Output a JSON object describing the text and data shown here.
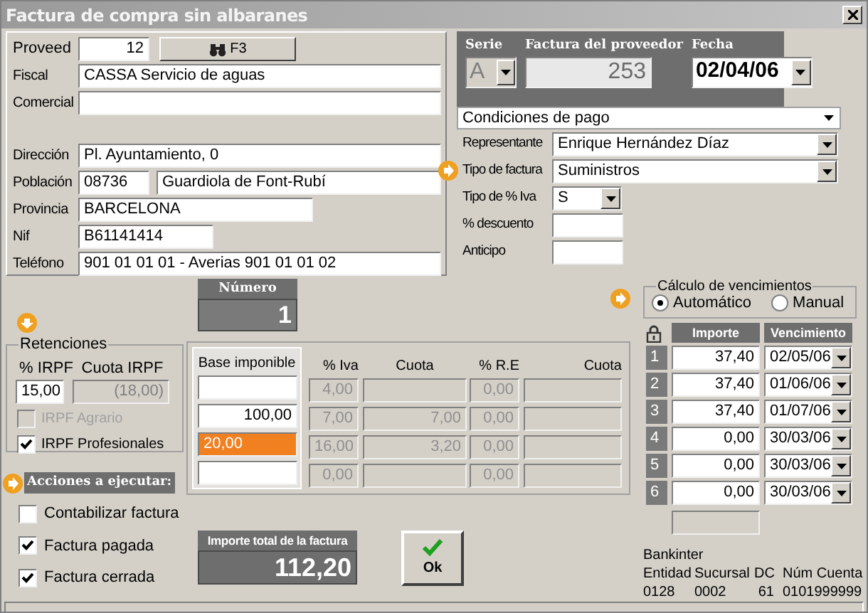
{
  "window": {
    "title": "Factura de compra sin albaranes"
  },
  "proveedor": {
    "label": "Proveed",
    "value": "12",
    "search_button": "F3"
  },
  "supplier_fields": [
    {
      "label": "Fiscal",
      "values": [
        "CASSA Servicio de aguas"
      ]
    },
    {
      "label": "Comercial"
    },
    {
      "label": "Dirección",
      "values": [
        "Pl. Ayuntamiento, 0"
      ]
    },
    {
      "label": "Población",
      "values": [
        "08736",
        "Guardiola de Font-Rubí"
      ]
    },
    {
      "label": "Provincia",
      "values": [
        "BARCELONA"
      ]
    },
    {
      "label": "Nif",
      "values": [
        "B61141414"
      ]
    },
    {
      "label": "Teléfono",
      "values": [
        "901 01 01 01 - Averias 901 01 01 02"
      ]
    }
  ],
  "invoice_header": {
    "serie": {
      "label": "Serie",
      "value": "A"
    },
    "number": {
      "label": "Factura del proveedor",
      "value": "253"
    },
    "date": {
      "label": "Fecha",
      "value": "02/04/06"
    }
  },
  "payment_conditions": "Condiciones de pago",
  "details": [
    {
      "label": "Representante",
      "value": "Enrique Hernández Díaz",
      "kind": "dropdown",
      "marked": false
    },
    {
      "label": "Tipo de factura",
      "value": "Suministros",
      "kind": "dropdown",
      "marked": true
    },
    {
      "label": "Tipo de % Iva",
      "value": "S",
      "kind": "dropdown",
      "marked": false
    },
    {
      "label": "% descuento",
      "kind": "field",
      "marked": false
    },
    {
      "label": "Anticipo",
      "kind": "field",
      "marked": false
    }
  ],
  "numero": {
    "label": "Número",
    "value": "1"
  },
  "retenciones": {
    "title": "Retenciones",
    "irpf_label": "% IRPF",
    "irpf": "15,00",
    "cuota_label": "Cuota IRPF",
    "cuota": "(18,00)",
    "options": [
      {
        "label": "IRPF Agrario",
        "checked": false,
        "disabled": true
      },
      {
        "label": "IRPF Profesionales",
        "checked": true,
        "disabled": false
      }
    ]
  },
  "tax_table": {
    "columns": [
      "Base imponible",
      "% Iva",
      "Cuota",
      "% R.E",
      "Cuota"
    ],
    "rows": [
      {
        "iva": "4,00",
        "re": "0,00",
        "focused": false
      },
      {
        "base": "100,00",
        "iva": "7,00",
        "cuota": "7,00",
        "re": "0,00",
        "focused": false
      },
      {
        "base": "20,00",
        "iva": "16,00",
        "cuota": "3,20",
        "re": "0,00",
        "focused": true
      },
      {
        "iva": "0,00",
        "re": "0,00",
        "focused": false
      }
    ]
  },
  "acciones": {
    "title": "Acciones a ejecutar:",
    "items": [
      {
        "label": "Contabilizar factura",
        "checked": false
      },
      {
        "label": "Factura pagada",
        "checked": true
      },
      {
        "label": "Factura cerrada",
        "checked": true
      }
    ]
  },
  "total": {
    "label": "Importe total de la factura",
    "value": "112,20"
  },
  "ok_button": "Ok",
  "vencimientos": {
    "title": "Cálculo de vencimientos",
    "modes": [
      {
        "label": "Automático",
        "selected": true
      },
      {
        "label": "Manual",
        "selected": false
      }
    ],
    "columns": [
      "Importe",
      "Vencimiento"
    ],
    "rows": [
      {
        "number": "1",
        "amount": "37,40",
        "date": "02/05/06"
      },
      {
        "number": "2",
        "amount": "37,40",
        "date": "01/06/06"
      },
      {
        "number": "3",
        "amount": "37,40",
        "date": "01/07/06"
      },
      {
        "number": "4",
        "amount": "0,00",
        "date": "30/03/06"
      },
      {
        "number": "5",
        "amount": "0,00",
        "date": "30/03/06"
      },
      {
        "number": "6",
        "amount": "0,00",
        "date": "30/03/06"
      }
    ]
  },
  "bank": {
    "name": "Bankinter",
    "columns": [
      "Entidad",
      "Sucursal",
      "DC",
      "Núm Cuenta"
    ],
    "values": [
      "0128",
      "0002",
      "61",
      "0101999999"
    ]
  }
}
